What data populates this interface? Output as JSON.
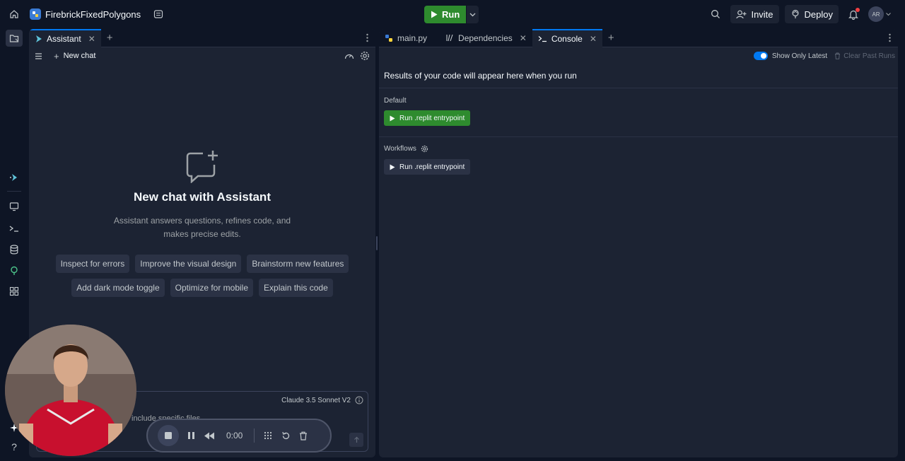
{
  "topbar": {
    "project_name": "FirebrickFixedPolygons",
    "run_label": "Run",
    "invite_label": "Invite",
    "deploy_label": "Deploy",
    "avatar_initials": "AR"
  },
  "assistant": {
    "tab_label": "Assistant",
    "new_chat_label": "New chat",
    "empty_title": "New chat with Assistant",
    "empty_sub_line1": "Assistant answers questions, refines code, and",
    "empty_sub_line2": "makes precise edits.",
    "suggestions_row1": [
      "Inspect for errors",
      "Improve the visual design",
      "Brainstorm new features"
    ],
    "suggestions_row2": [
      "Add dark mode toggle",
      "Optimize for mobile",
      "Explain this code"
    ],
    "model_label": "Claude 3.5 Sonnet V2",
    "input_placeholder": "include specific files"
  },
  "tabs": {
    "main": "main.py",
    "dependencies": "Dependencies",
    "console": "Console"
  },
  "console": {
    "show_only_latest": "Show Only Latest",
    "clear_past_runs": "Clear Past Runs",
    "results_text": "Results of your code will appear here when you run",
    "default_label": "Default",
    "default_run": "Run .replit entrypoint",
    "workflows_label": "Workflows",
    "workflows_run": "Run .replit entrypoint"
  },
  "recorder": {
    "time": "0:00"
  },
  "colors": {
    "background": "#0e1525",
    "panel": "#1c2333",
    "run_green": "#2e8b2e",
    "accent_blue": "#0079f2"
  }
}
